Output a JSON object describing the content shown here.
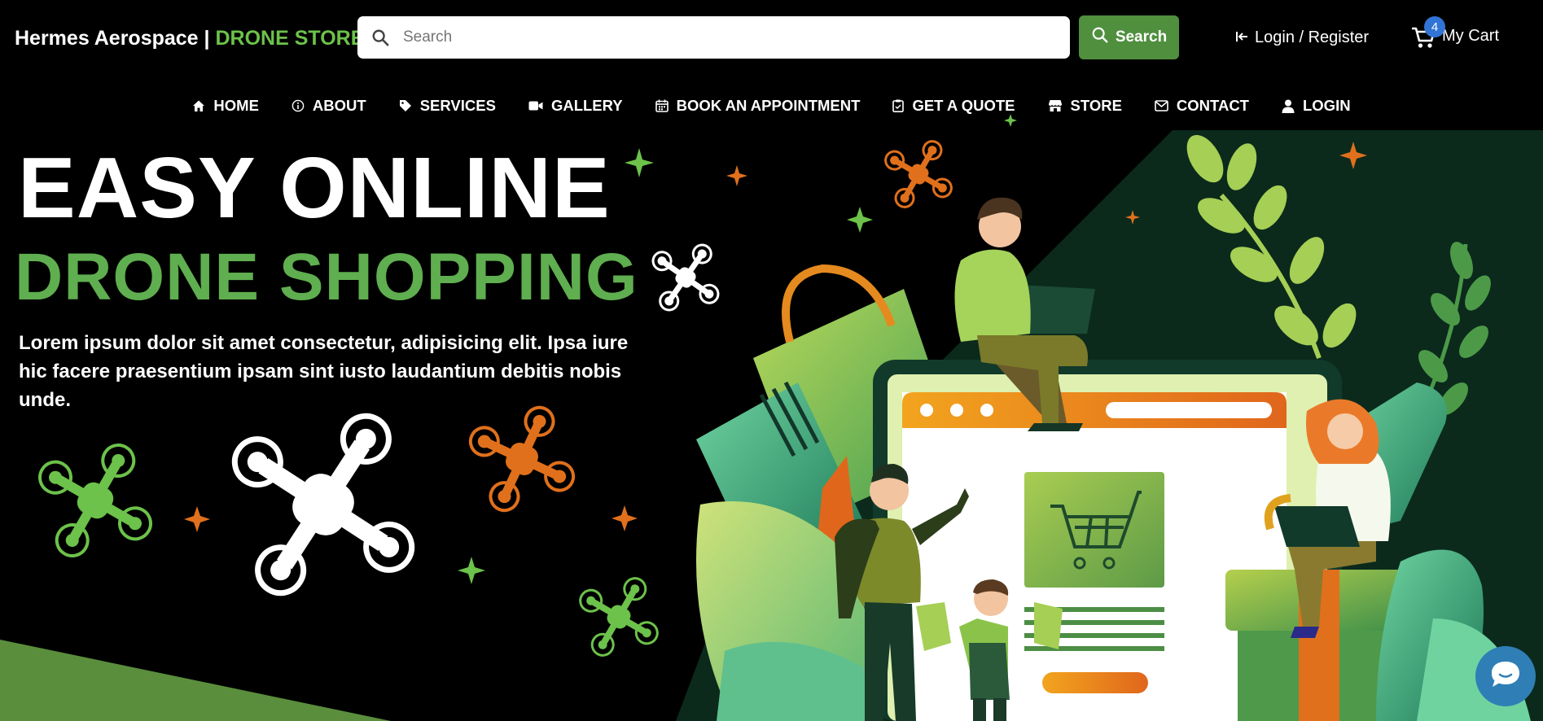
{
  "header": {
    "brand_name": "Hermes Aerospace | ",
    "brand_accent": "DRONE STORE",
    "search_placeholder": "Search",
    "search_button_label": "Search",
    "login_label": "Login / Register",
    "cart_label": "My Cart",
    "cart_count": "4"
  },
  "nav": {
    "items": [
      {
        "label": "HOME",
        "icon": "home-icon"
      },
      {
        "label": "ABOUT",
        "icon": "info-icon"
      },
      {
        "label": "SERVICES",
        "icon": "tag-icon"
      },
      {
        "label": "GALLERY",
        "icon": "video-icon"
      },
      {
        "label": "BOOK AN APPOINTMENT",
        "icon": "calendar-icon"
      },
      {
        "label": "GET A QUOTE",
        "icon": "clipboard-icon"
      },
      {
        "label": "STORE",
        "icon": "store-icon"
      },
      {
        "label": "CONTACT",
        "icon": "mail-icon"
      },
      {
        "label": "LOGIN",
        "icon": "user-icon"
      }
    ]
  },
  "hero": {
    "title_line1": "EASY ONLINE",
    "title_line2": "DRONE SHOPPING",
    "description": "Lorem ipsum dolor sit amet consectetur, adipisicing elit. Ipsa iure hic facere praesentium ipsam sint iusto laudantium debitis nobis unde."
  },
  "colors": {
    "accent_green": "#5fae4f",
    "button_green": "#4f8f3e",
    "orange": "#e0701c",
    "cart_badge": "#3274d6",
    "chat_button": "#2f7fb6"
  },
  "chat": {
    "icon": "chat-icon"
  }
}
